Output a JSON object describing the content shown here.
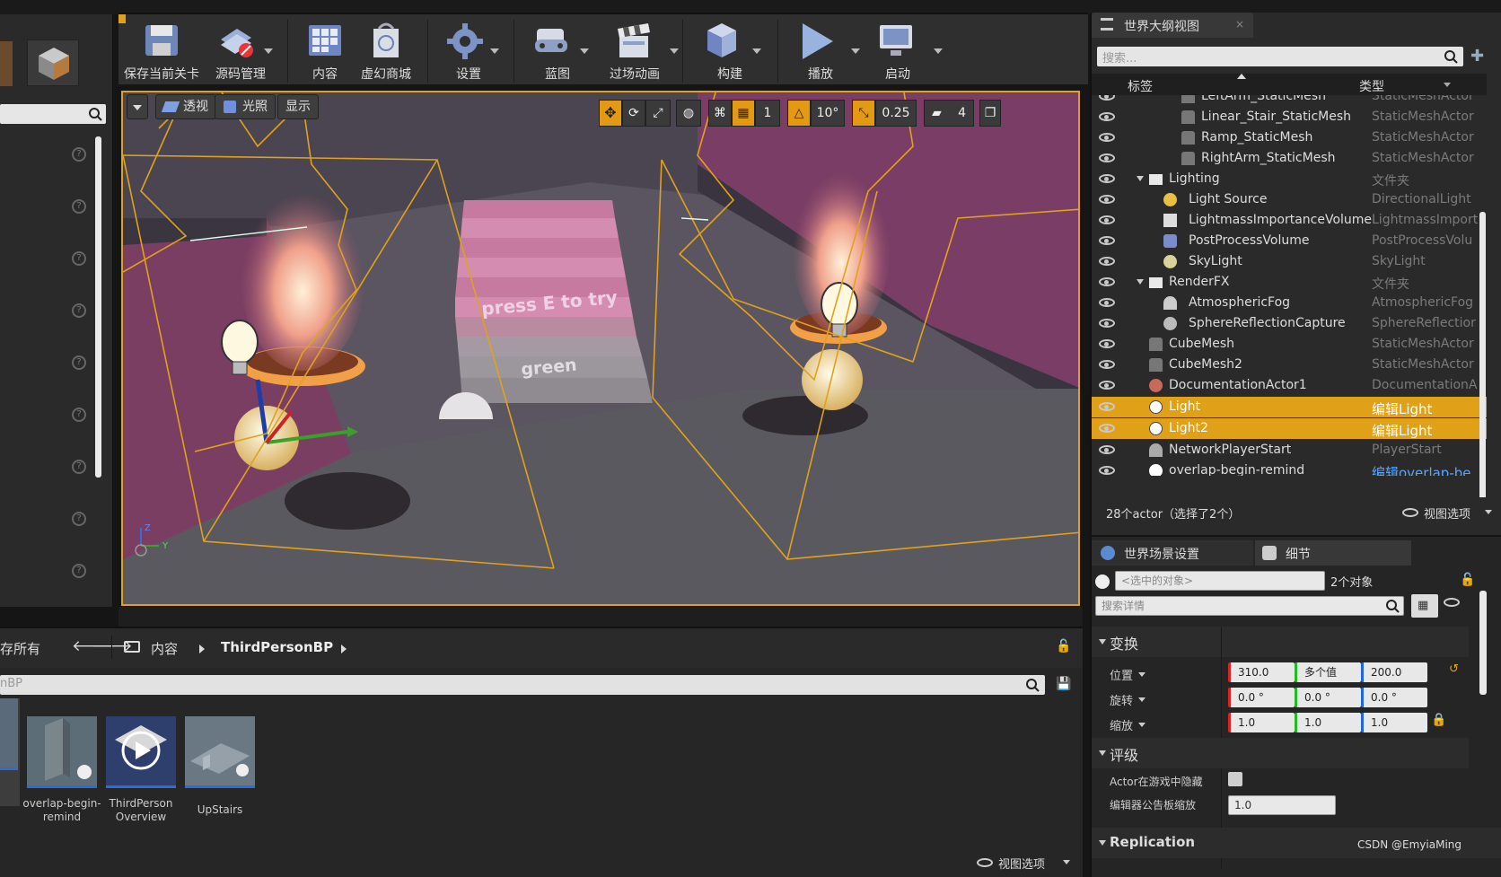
{
  "toolbar": {
    "save_current": "保存当前关卡",
    "source_control": "源码管理",
    "content": "内容",
    "marketplace": "虚幻商城",
    "settings": "设置",
    "blueprints": "蓝图",
    "cinematics": "过场动画",
    "build": "构建",
    "play": "播放",
    "launch": "启动"
  },
  "viewport": {
    "perspective": "透视",
    "lit": "光照",
    "show": "显示",
    "grid_snap": "1",
    "rotation_snap": "10°",
    "scale_snap": "0.25",
    "camera_speed": "4",
    "text_press_e": "press E to try",
    "text_green": "green",
    "axis_z": "Z",
    "axis_y": "Y"
  },
  "outliner": {
    "tab": "世界大纲视图",
    "search_placeholder": "搜索...",
    "col_label": "标签",
    "col_type": "类型",
    "rows": [
      {
        "name": "LeftArm_StaticMesh",
        "type": "StaticMeshActor"
      },
      {
        "name": "Linear_Stair_StaticMesh",
        "type": "StaticMeshActor"
      },
      {
        "name": "Ramp_StaticMesh",
        "type": "StaticMeshActor"
      },
      {
        "name": "RightArm_StaticMesh",
        "type": "StaticMeshActor"
      },
      {
        "name": "Lighting",
        "type": "文件夹"
      },
      {
        "name": "Light Source",
        "type": "DirectionalLight"
      },
      {
        "name": "LightmassImportanceVolume",
        "type": "LightmassImport"
      },
      {
        "name": "PostProcessVolume",
        "type": "PostProcessVolu"
      },
      {
        "name": "SkyLight",
        "type": "SkyLight"
      },
      {
        "name": "RenderFX",
        "type": "文件夹"
      },
      {
        "name": "AtmosphericFog",
        "type": "AtmosphericFog"
      },
      {
        "name": "SphereReflectionCapture",
        "type": "SphereReflectior"
      },
      {
        "name": "CubeMesh",
        "type": "StaticMeshActor"
      },
      {
        "name": "CubeMesh2",
        "type": "StaticMeshActor"
      },
      {
        "name": "DocumentationActor1",
        "type": "DocumentationA"
      },
      {
        "name": "Light",
        "type": "编辑Light"
      },
      {
        "name": "Light2",
        "type": "编辑Light"
      },
      {
        "name": "NetworkPlayerStart",
        "type": "PlayerStart"
      },
      {
        "name": "overlap-begin-remind",
        "type": "编辑overlap-be"
      }
    ],
    "status": "28个actor（选择了2个）",
    "view_options": "视图选项"
  },
  "details": {
    "tab_world": "世界场景设置",
    "tab_details": "细节",
    "selected_placeholder": "<选中的对象>",
    "object_count": "2个对象",
    "search_placeholder": "搜索详情",
    "transform": "变换",
    "location": "位置",
    "rotation": "旋转",
    "scale": "缩放",
    "loc_x": "310.0",
    "loc_y": "多个值",
    "loc_z": "200.0",
    "rot_x": "0.0 °",
    "rot_y": "0.0 °",
    "rot_z": "0.0 °",
    "scl_x": "1.0",
    "scl_y": "1.0",
    "scl_z": "1.0",
    "rendering": "评级",
    "hidden_in_game": "Actor在游戏中隐藏",
    "billboard_scale": "编辑器公告板缩放",
    "billboard_value": "1.0",
    "replication": "Replication",
    "watermark": "CSDN @EmyiaMing"
  },
  "content_browser": {
    "save_all": "存所有",
    "crumb_content": "内容",
    "crumb_folder": "ThirdPersonBP",
    "filter_text": "nBP",
    "assets": [
      {
        "line1": "overlap-begin-",
        "line2": "remind"
      },
      {
        "line1": "ThirdPerson",
        "line2": "Overview"
      },
      {
        "line1": "UpStairs",
        "line2": ""
      }
    ],
    "view_options": "视图选项"
  }
}
